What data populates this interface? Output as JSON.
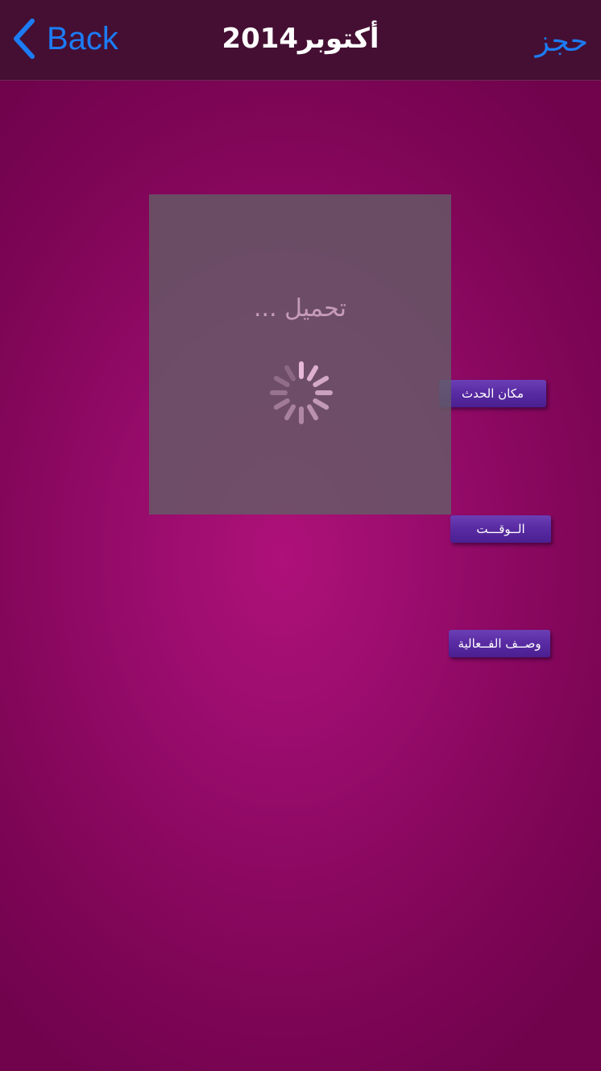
{
  "navbar": {
    "back_label": "Back",
    "title": "أكتوبر2014",
    "book_label": "حجز",
    "accent_color": "#1c7cf5",
    "icons": {
      "back": "chevron-left-icon"
    }
  },
  "tags": {
    "venue": "مكان الحدث",
    "time": "الــوقـــت",
    "description": "وصــف الفــعالية"
  },
  "loading": {
    "text": "تحميل ...",
    "icon": "spinner-icon"
  },
  "colors": {
    "navbar_bg": "#450f33",
    "background": "#980c6c",
    "tag_bg": "#5a2ca4"
  }
}
